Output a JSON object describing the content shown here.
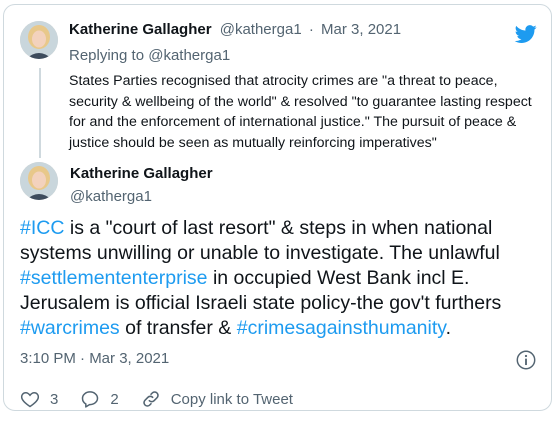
{
  "quoted_tweet": {
    "author_name": "Katherine Gallagher",
    "author_handle": "@katherga1",
    "separator": "·",
    "date": "Mar 3, 2021",
    "replying_prefix": "Replying to ",
    "replying_handle": "@katherga1",
    "text": "States Parties recognised that atrocity crimes are \"a threat to peace, security & wellbeing of the world\" & resolved \"to guarantee lasting respect for and the enforcement of international justice.\" The pursuit of peace & justice should be seen as mutually reinforcing imperatives\""
  },
  "main_tweet": {
    "author_name": "Katherine Gallagher",
    "author_handle": "@katherga1",
    "text_parts": {
      "t1": "#ICC",
      "t2": " is a \"court of last resort\" & steps in when national systems unwilling or unable to investigate. The unlawful ",
      "t3": "#settlemententerprise",
      "t4": " in occupied West Bank incl E. Jerusalem is official Israeli state policy-the gov't furthers ",
      "t5": "#warcrimes",
      "t6": " of transfer & ",
      "t7": "#crimesagainsthumanity",
      "t8": "."
    },
    "timestamp": "3:10 PM · Mar 3, 2021"
  },
  "actions": {
    "likes": "3",
    "replies": "2",
    "copy_link": "Copy link to Tweet"
  },
  "colors": {
    "link": "#1d9bf0",
    "muted": "#536471",
    "like": "#536471"
  }
}
